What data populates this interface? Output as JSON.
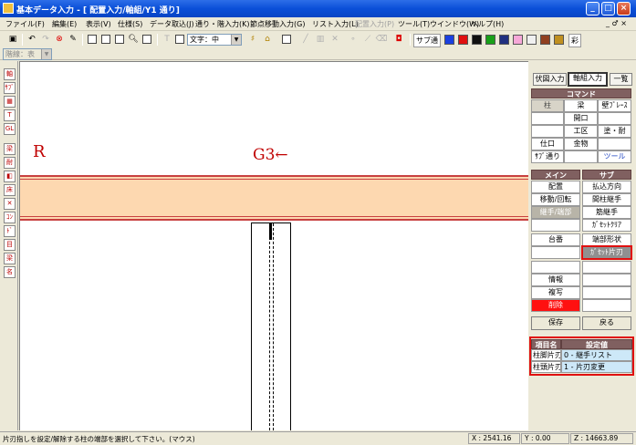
{
  "window": {
    "title": "基本データ入力 - [ 配置入力/軸組/Y1 通り]",
    "minimize": "_",
    "maximize": "□",
    "close": "×"
  },
  "menu": {
    "items": [
      {
        "label": "ファイル(F)",
        "disabled": false
      },
      {
        "label": "編集(E)",
        "disabled": false
      },
      {
        "label": "表示(V)",
        "disabled": false
      },
      {
        "label": "仕様(S)",
        "disabled": false
      },
      {
        "label": "データ取込(J)",
        "disabled": false
      },
      {
        "label": "通り・階入力(K)",
        "disabled": false
      },
      {
        "label": "節点移動入力(G)",
        "disabled": false
      },
      {
        "label": "リスト入力(L)",
        "disabled": false
      },
      {
        "label": "配置入力(P)",
        "disabled": true
      },
      {
        "label": "ツール(T)",
        "disabled": false
      },
      {
        "label": "ウインドウ(W)",
        "disabled": false
      },
      {
        "label": "ヘルプ(H)",
        "disabled": false
      }
    ],
    "mdi_controls": "_ ♂ ×"
  },
  "toolbar": {
    "text_combo": "文字：中",
    "sub_label": "サブ通",
    "colors": [
      "#1a40e0",
      "#e01010",
      "#101010",
      "#18a018",
      "#203080",
      "#f6a8d8",
      "#f0f0f0",
      "#904020",
      "#c09020"
    ],
    "last_label": "彩"
  },
  "toolbar2": {
    "floor_combo": "階線：表"
  },
  "left_tools": [
    "軸",
    "ｻﾌﾞ",
    "▦",
    "T柱",
    "GL",
    "梁",
    "耐",
    "◧",
    "床",
    "✕",
    "ｺﾝ",
    "ﾄﾞ",
    "目",
    "梁",
    "名"
  ],
  "canvas": {
    "axis_label": "R",
    "grid_label": "G3←"
  },
  "right_panel": {
    "tabs": [
      "伏図入力",
      "軸組入力",
      "一覧"
    ],
    "command_header": "コマンド",
    "commands": [
      [
        "柱",
        "梁",
        "壁ﾌﾞﾚｰｽ"
      ],
      [
        "",
        "開口",
        ""
      ],
      [
        "",
        "工区",
        "塗・耐"
      ],
      [
        "仕口",
        "金物",
        ""
      ],
      [
        "ｻﾌﾞ通り",
        "",
        "ツール"
      ]
    ],
    "main_header": "メイン",
    "sub_header": "サブ",
    "main_buttons": [
      "配置",
      "移動/回転",
      "継手/端部",
      "",
      "台番",
      "",
      "",
      "情報",
      "複写",
      "削除"
    ],
    "sub_buttons": [
      "払込方向",
      "間柱継手",
      "筋継手",
      "ｶﾞｾｯﾄｸﾘｱ",
      "端部形状",
      "ｶﾞｾｯﾄ片刃",
      "",
      "",
      "",
      ""
    ],
    "save": "保存",
    "back": "戻る",
    "settings": {
      "headers": [
        "項目名",
        "設定値"
      ],
      "rows": [
        {
          "key": "柱脚片刃",
          "value": "0 - 継手リスト"
        },
        {
          "key": "柱頭片刃",
          "value": "1 - 片刃変更"
        }
      ]
    }
  },
  "status": {
    "message": "片刃指しを設定/解除する柱の端部を選択して下さい。(マウス)",
    "x": "X : 2541.16",
    "y": "Y : 0.00",
    "z": "Z : 14663.89"
  }
}
